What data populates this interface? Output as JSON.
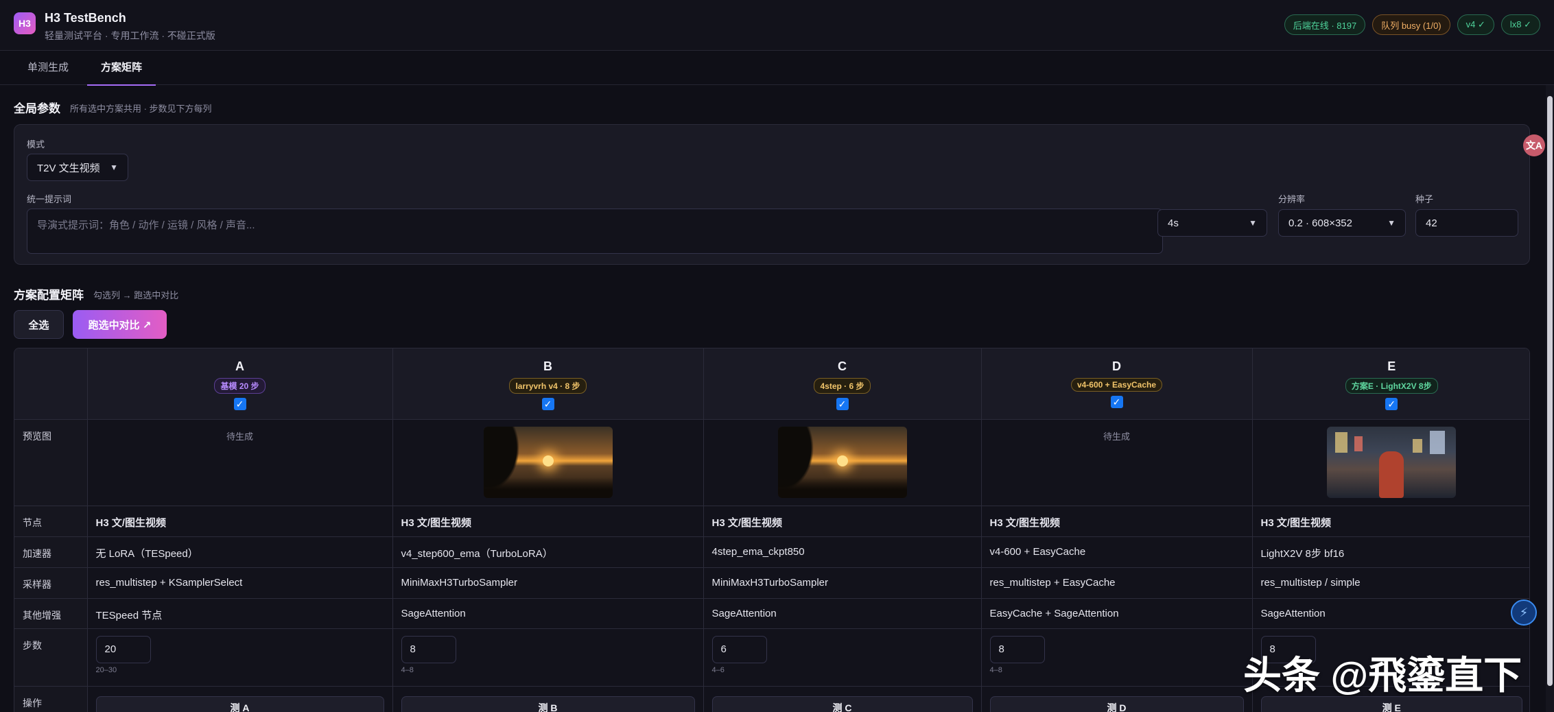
{
  "app": {
    "logo": "H3",
    "title": "H3 TestBench",
    "subtitle": "轻量测试平台 · 专用工作流 · 不碰正式版"
  },
  "badges": [
    {
      "label": "后端在线 · 8197",
      "color": "#4fd39b"
    },
    {
      "label": "队列 busy (1/0)",
      "color": "#f2b066"
    },
    {
      "label": "v4 ✓",
      "color": "#4fd39b"
    },
    {
      "label": "lx8 ✓",
      "color": "#4fd39b"
    }
  ],
  "tabs": [
    {
      "label": "单测生成",
      "active": false
    },
    {
      "label": "方案矩阵",
      "active": true
    }
  ],
  "global": {
    "title": "全局参数",
    "hint": "所有选中方案共用 · 步数见下方每列",
    "mode_label": "模式",
    "mode_value": "T2V 文生视频",
    "prompt_label": "统一提示词",
    "prompt_placeholder": "导演式提示词：角色 / 动作 / 运镜 / 风格 / 声音...",
    "duration_value": "4s",
    "resolution_label": "分辨率",
    "resolution_value": "0.2 · 608×352",
    "seed_label": "种子",
    "seed_value": "42"
  },
  "matrix": {
    "title": "方案配置矩阵",
    "hint": "勾选列 → 跑选中对比",
    "select_all": "全选",
    "run_selected": "跑选中对比 ↗",
    "row_labels": {
      "preview": "预览图",
      "node": "节点",
      "accelerator": "加速器",
      "sampler": "采样器",
      "extras": "其他增强",
      "steps": "步数",
      "action": "操作"
    },
    "pending_text": "待生成",
    "columns": [
      {
        "letter": "A",
        "tag": "基模 20 步",
        "tag_color": "purple",
        "checked": true,
        "preview": "pending",
        "node": "H3 文/图生视频",
        "accelerator": "无 LoRA（TESpeed）",
        "sampler": "res_multistep + KSamplerSelect",
        "extras": "TESpeed 节点",
        "steps": "20",
        "range": "20–30",
        "action": "测 A"
      },
      {
        "letter": "B",
        "tag": "larryvrh v4 · 8 步",
        "tag_color": "yellow",
        "checked": true,
        "preview": "sunset",
        "node": "H3 文/图生视频",
        "accelerator": "v4_step600_ema（TurboLoRA）",
        "sampler": "MiniMaxH3TurboSampler",
        "extras": "SageAttention",
        "steps": "8",
        "range": "4–8",
        "action": "测 B"
      },
      {
        "letter": "C",
        "tag": "4step · 6 步",
        "tag_color": "yellow",
        "checked": true,
        "preview": "sunset",
        "node": "H3 文/图生视频",
        "accelerator": "4step_ema_ckpt850",
        "sampler": "MiniMaxH3TurboSampler",
        "extras": "SageAttention",
        "steps": "6",
        "range": "4–6",
        "action": "测 C"
      },
      {
        "letter": "D",
        "tag": "v4-600 + EasyCache",
        "tag_color": "yellow",
        "checked": true,
        "preview": "pending",
        "node": "H3 文/图生视频",
        "accelerator": "v4-600 + EasyCache",
        "sampler": "res_multistep + EasyCache",
        "extras": "EasyCache + SageAttention",
        "steps": "8",
        "range": "4–8",
        "action": "测 D"
      },
      {
        "letter": "E",
        "tag": "方案E · LightX2V 8步",
        "tag_color": "green",
        "checked": true,
        "preview": "city",
        "node": "H3 文/图生视频",
        "accelerator": "LightX2V 8步 bf16",
        "sampler": "res_multistep / simple",
        "extras": "SageAttention",
        "steps": "8",
        "range": "",
        "action": "测 E"
      }
    ]
  },
  "watermark": "头条 @飛鎏直下",
  "icons": {
    "translate": "translate-icon",
    "assistant": "assistant-icon"
  }
}
